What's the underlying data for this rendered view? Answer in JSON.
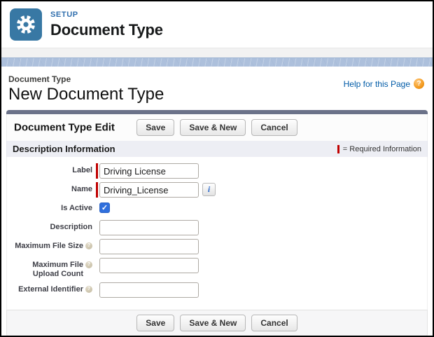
{
  "setup_header": {
    "eyebrow": "SETUP",
    "title": "Document Type"
  },
  "page_header": {
    "breadcrumb": "Document Type",
    "title": "New Document Type",
    "help_link": "Help for this Page"
  },
  "panel": {
    "title": "Document Type Edit",
    "buttons": [
      "Save",
      "Save & New",
      "Cancel"
    ],
    "section": {
      "title": "Description Information",
      "required_note": "= Required Information"
    }
  },
  "form": {
    "fields": [
      {
        "label": "Label",
        "type": "text",
        "value": "Driving License",
        "required": true
      },
      {
        "label": "Name",
        "type": "text",
        "value": "Driving_License",
        "required": true,
        "info": true
      },
      {
        "label": "Is Active",
        "type": "checkbox",
        "checked": true
      },
      {
        "label": "Description",
        "type": "text",
        "value": ""
      },
      {
        "label": "Maximum File Size",
        "type": "text",
        "value": "",
        "help": true
      },
      {
        "label": "Maximum File\nUpload Count",
        "type": "text",
        "value": "",
        "help": true
      },
      {
        "label": "External Identifier",
        "type": "text",
        "value": "",
        "help": true
      }
    ]
  },
  "icons": {
    "gear": "gear-icon",
    "help_glyph": "?",
    "info_glyph": "i",
    "check_glyph": "✓"
  },
  "colors": {
    "setup_tile_blue": "#3878a4",
    "eyebrow_blue": "#2f6ead",
    "band_blue": "#adc0dc",
    "link_blue": "#015ba7",
    "required_red": "#c00000",
    "checkbox_blue": "#2f6fdd",
    "section_bar": "#edeef4",
    "panel_topbar": "#6b7289",
    "help_orb_orange": "#f39a1e"
  }
}
